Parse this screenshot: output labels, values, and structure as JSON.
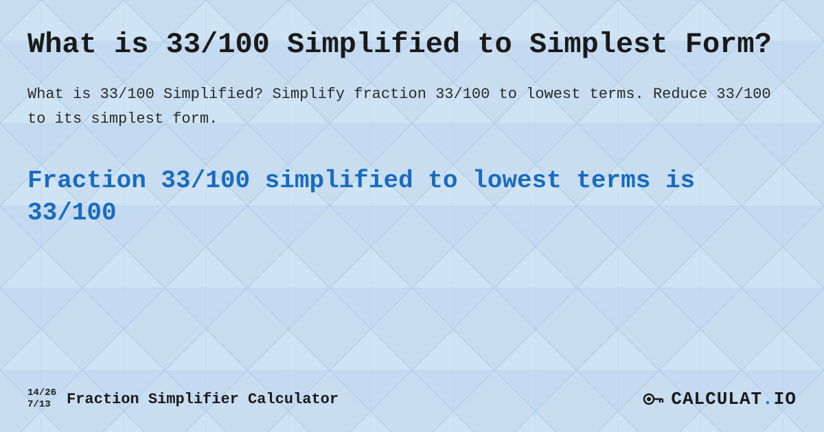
{
  "page": {
    "background_color": "#c8ddf0",
    "main_title": "What is 33/100 Simplified to Simplest Form?",
    "description": "What is 33/100 Simplified? Simplify fraction 33/100 to lowest terms. Reduce 33/100 to its simplest form.",
    "result_text": "Fraction 33/100 simplified to lowest terms is 33/100",
    "footer": {
      "fraction1": "14/26",
      "fraction2": "7/13",
      "label": "Fraction Simplifier Calculator",
      "logo_text": "CALCULAT.IO"
    }
  }
}
